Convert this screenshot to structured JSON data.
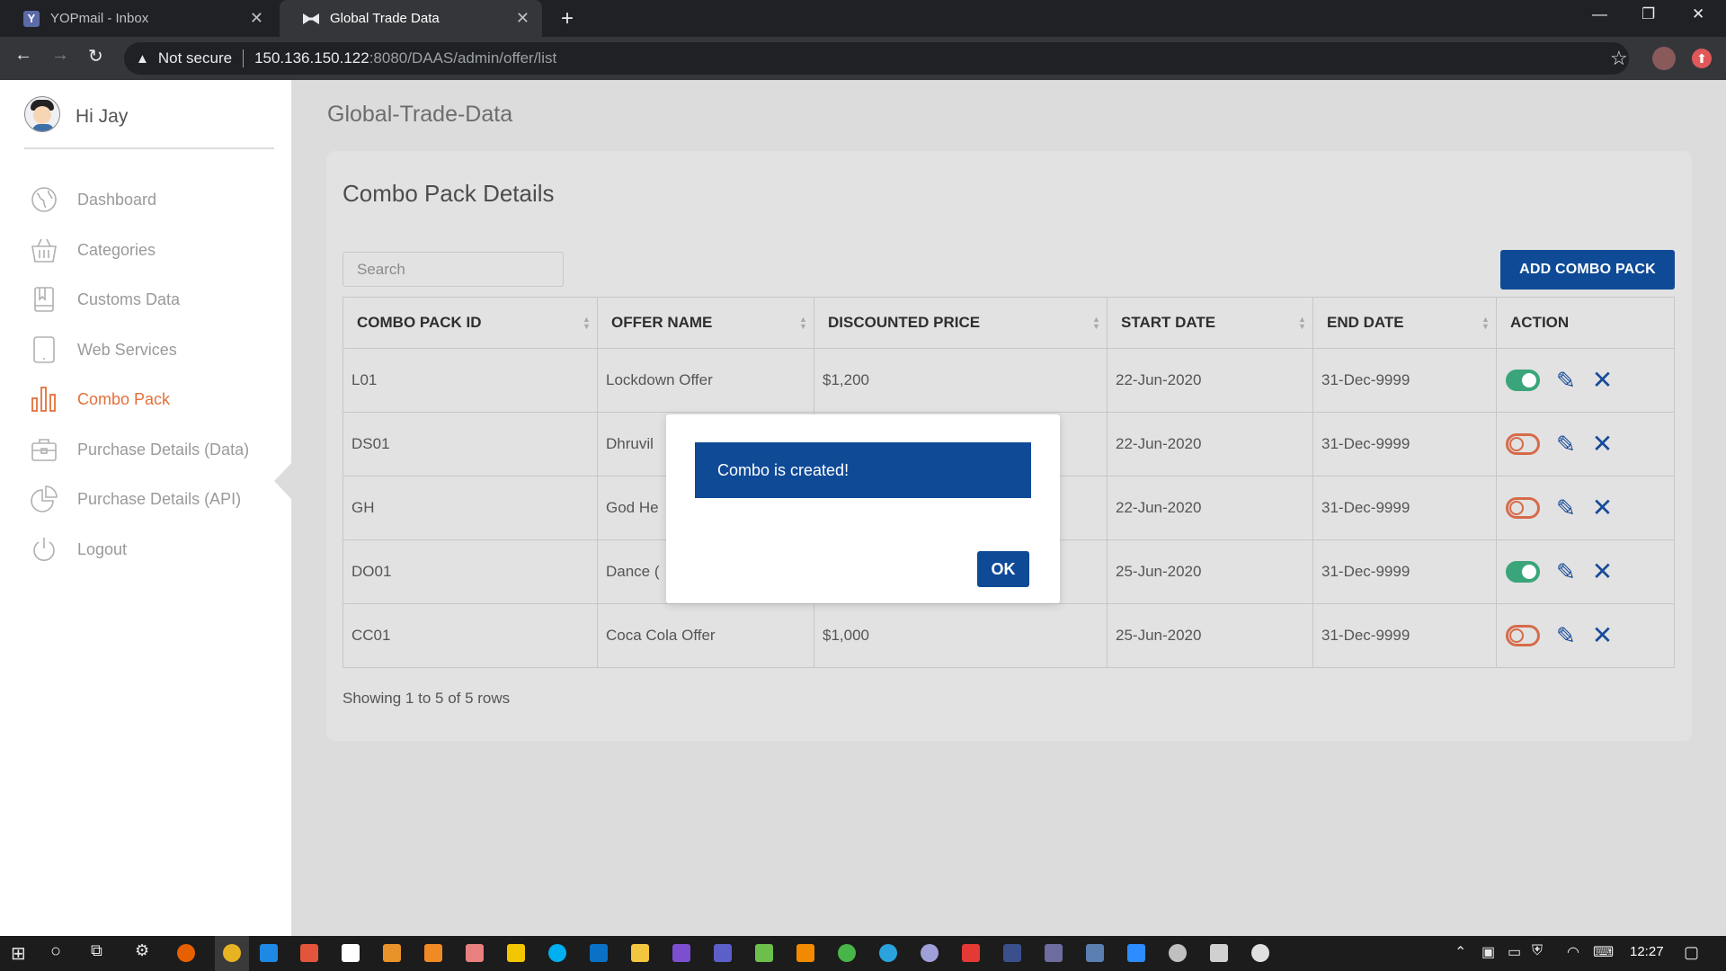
{
  "browser": {
    "tabs": [
      {
        "title": "YOPmail - Inbox",
        "favicon": "Y"
      },
      {
        "title": "Global Trade Data",
        "favicon": "bowtie-icon"
      }
    ],
    "security_label": "Not secure",
    "url_host": "150.136.150.122",
    "url_path": ":8080/DAAS/admin/offer/list"
  },
  "sidebar": {
    "greeting": "Hi Jay",
    "items": [
      {
        "label": "Dashboard",
        "icon": "globe-icon"
      },
      {
        "label": "Categories",
        "icon": "basket-icon"
      },
      {
        "label": "Customs Data",
        "icon": "book-icon"
      },
      {
        "label": "Web Services",
        "icon": "tablet-icon"
      },
      {
        "label": "Combo Pack",
        "icon": "bar-chart-icon",
        "active": true
      },
      {
        "label": "Purchase Details (Data)",
        "icon": "briefcase-icon"
      },
      {
        "label": "Purchase Details (API)",
        "icon": "pie-chart-icon"
      },
      {
        "label": "Logout",
        "icon": "power-icon"
      }
    ]
  },
  "main": {
    "page_title": "Global-Trade-Data",
    "card_title": "Combo Pack Details",
    "search_placeholder": "Search",
    "add_button": "ADD COMBO PACK",
    "columns": [
      "COMBO PACK ID",
      "OFFER NAME",
      "DISCOUNTED PRICE",
      "START DATE",
      "END DATE",
      "ACTION"
    ],
    "rows": [
      {
        "id": "L01",
        "offer": "Lockdown Offer",
        "price": "$1,200",
        "start": "22-Jun-2020",
        "end": "31-Dec-9999",
        "enabled": true
      },
      {
        "id": "DS01",
        "offer": "Dhruvil",
        "price": "",
        "start": "22-Jun-2020",
        "end": "31-Dec-9999",
        "enabled": false
      },
      {
        "id": "GH",
        "offer": "God He",
        "price": "",
        "start": "22-Jun-2020",
        "end": "31-Dec-9999",
        "enabled": false
      },
      {
        "id": "DO01",
        "offer": "Dance (",
        "price": "",
        "start": "25-Jun-2020",
        "end": "31-Dec-9999",
        "enabled": true
      },
      {
        "id": "CC01",
        "offer": "Coca Cola Offer",
        "price": "$1,000",
        "start": "25-Jun-2020",
        "end": "31-Dec-9999",
        "enabled": false
      }
    ],
    "footer_text": "Showing 1 to 5 of 5 rows"
  },
  "modal": {
    "message": "Combo is created!",
    "ok_label": "OK"
  },
  "taskbar": {
    "time": "12:27"
  },
  "colors": {
    "primary": "#0f4a97",
    "active_nav": "#e2703a",
    "toggle_on": "#3aa57a",
    "toggle_off": "#d66b4a"
  }
}
